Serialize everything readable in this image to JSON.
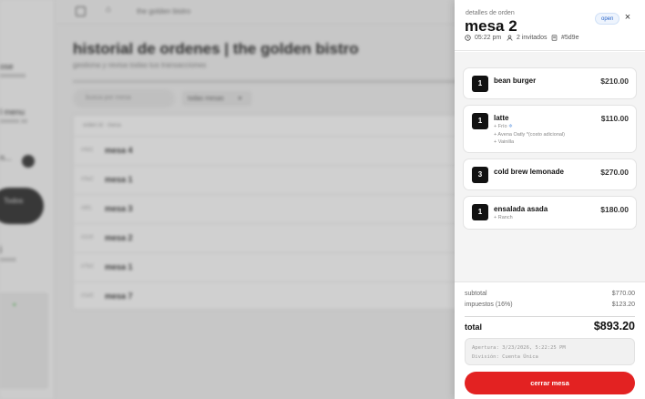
{
  "background": {
    "sidebar": {
      "items": [
        "ose",
        "l menu",
        "n...",
        "Todos",
        "j"
      ],
      "subs": [
        "xxxxxxxx",
        "xxxxxx xx",
        "",
        "",
        "xxxxx"
      ]
    },
    "topbar": {
      "breadcrumb": "the golden bistro"
    },
    "page_title": "historial de ordenes | the golden bistro",
    "page_subtitle": "gestiona y revisa todas tus transacciones",
    "search_placeholder": "busca por mesa",
    "filter_label": "todas mesas",
    "table_header": "orden id  ·  mesa",
    "rows": [
      {
        "id": "#4d1",
        "name": "mesa 4"
      },
      {
        "id": "#3a2",
        "name": "mesa 1"
      },
      {
        "id": "#8f1",
        "name": "mesa 3"
      },
      {
        "id": "#2c9",
        "name": "mesa 2"
      },
      {
        "id": "#7b3",
        "name": "mesa 1"
      },
      {
        "id": "#1e5",
        "name": "mesa 7"
      }
    ]
  },
  "drawer": {
    "eyebrow": "detalles de orden",
    "title": "mesa 2",
    "status": "open",
    "close_label": "×",
    "meta": {
      "time": "05:22 pm",
      "guests": "2 invitados",
      "order_id": "#5d9e"
    },
    "items": [
      {
        "qty": "1",
        "name": "bean burger",
        "price": "$210.00",
        "mods": []
      },
      {
        "qty": "1",
        "name": "latte",
        "price": "$110.00",
        "mods": [
          "+ Frío",
          "+ Avena Oatly *(costo adicional)",
          "+ Vainilla"
        ]
      },
      {
        "qty": "3",
        "name": "cold brew lemonade",
        "price": "$270.00",
        "mods": []
      },
      {
        "qty": "1",
        "name": "ensalada asada",
        "price": "$180.00",
        "mods": [
          "+ Ranch"
        ]
      }
    ],
    "summary": {
      "subtotal_label": "subtotal",
      "subtotal_value": "$770.00",
      "tax_label": "impuestos (16%)",
      "tax_value": "$123.20",
      "total_label": "total",
      "total_value": "$893.20"
    },
    "note": {
      "line1": "Apertura: 3/23/2026, 5:22:25 PM",
      "line2": "División: Cuenta Única"
    },
    "action_label": "cerrar mesa"
  },
  "colors": {
    "accent_red": "#e32222",
    "status_blue": "#2b66c9",
    "qty_badge": "#111111"
  }
}
